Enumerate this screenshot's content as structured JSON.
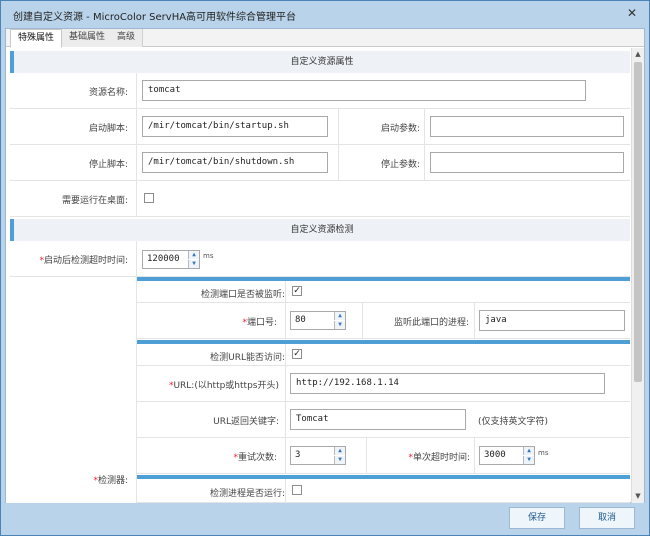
{
  "window": {
    "title": "创建自定义资源 - MicroColor ServHA高可用软件综合管理平台",
    "controls": {
      "close": "✕"
    }
  },
  "tabs": [
    {
      "label": "特殊属性",
      "active": true
    },
    {
      "label": "基础属性",
      "active": false
    },
    {
      "label": "高级",
      "active": false
    }
  ],
  "section1": {
    "title": "自定义资源属性"
  },
  "resource_name": {
    "label": "资源名称:",
    "value": "tomcat"
  },
  "start_script": {
    "label": "启动脚本:",
    "value": "/mir/tomcat/bin/startup.sh"
  },
  "start_params": {
    "label": "启动参数:",
    "value": ""
  },
  "stop_script": {
    "label": "停止脚本:",
    "value": "/mir/tomcat/bin/shutdown.sh"
  },
  "stop_params": {
    "label": "停止参数:",
    "value": ""
  },
  "run_on_desktop": {
    "label": "需要运行在桌面:",
    "checked": false
  },
  "section2": {
    "title": "自定义资源检测"
  },
  "detect_timeout": {
    "required_mark": "*",
    "label": "启动后检测超时时间:",
    "value": "120000",
    "unit": "ms"
  },
  "detector": {
    "required_mark": "*",
    "label": "检测器:"
  },
  "port_monitored": {
    "label": "检测端口是否被监听:",
    "checked": true
  },
  "port": {
    "required_mark": "*",
    "label": "端口号:",
    "value": "80"
  },
  "port_process": {
    "label": "监听此端口的进程:",
    "value": "java"
  },
  "url_accessible": {
    "label": "检测URL能否访问:",
    "checked": true
  },
  "url": {
    "required_mark": "*",
    "label": "URL:(以http或https开头)",
    "value": "http://192.168.1.14"
  },
  "url_keyword": {
    "label": "URL返回关键字:",
    "value": "Tomcat",
    "hint": "(仅支持英文字符)"
  },
  "retries": {
    "required_mark": "*",
    "label": "重试次数:",
    "value": "3"
  },
  "single_timeout": {
    "required_mark": "*",
    "label": "单次超时时间:",
    "value": "3000",
    "unit": "ms"
  },
  "process_running": {
    "label": "检测进程是否运行:",
    "checked": false
  },
  "buttons": {
    "save": "保存",
    "cancel": "取消"
  }
}
